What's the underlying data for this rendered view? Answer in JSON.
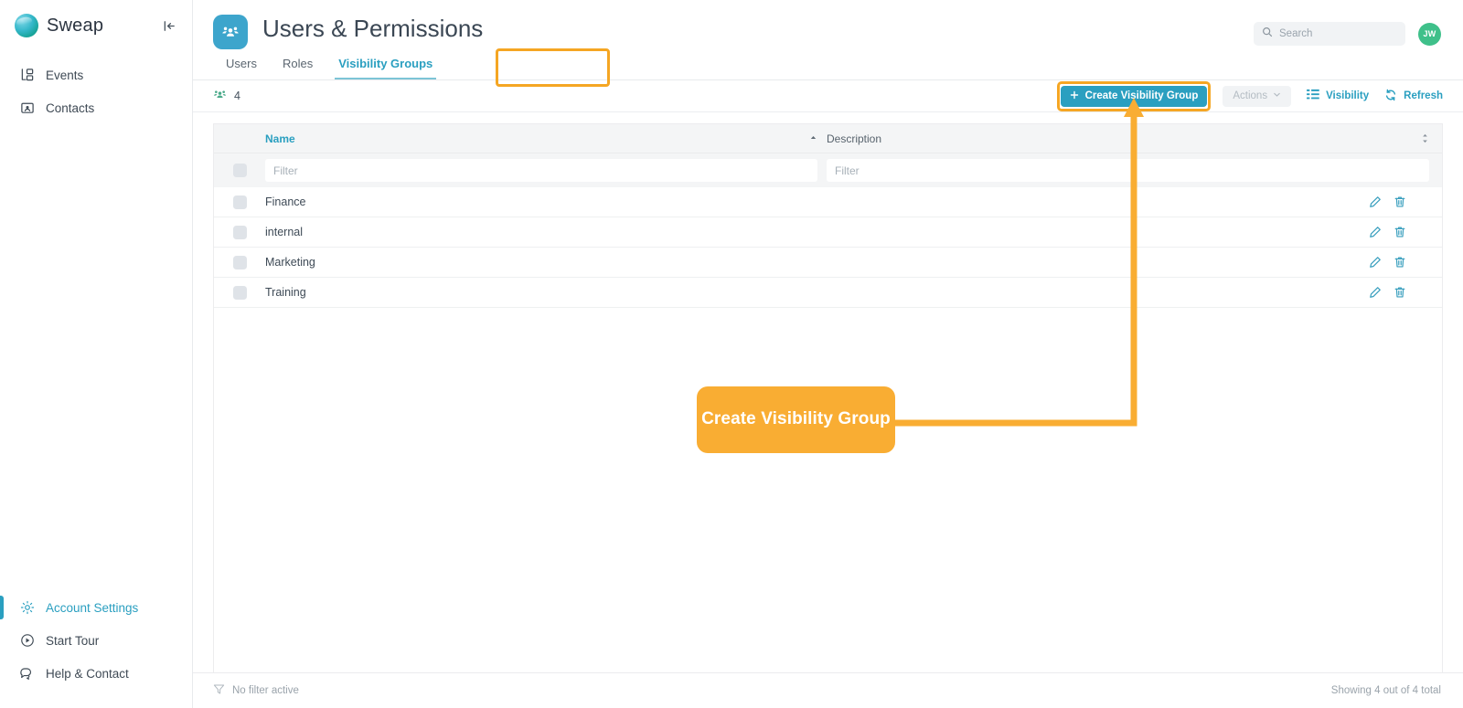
{
  "brand": {
    "name": "Sweap",
    "logo_icon": "sweap-logo-icon",
    "collapse_icon": "collapse-sidebar-icon"
  },
  "sidebar": {
    "top_items": [
      {
        "label": "Events",
        "icon": "events-icon"
      },
      {
        "label": "Contacts",
        "icon": "contacts-icon"
      }
    ],
    "bottom_items": [
      {
        "label": "Account Settings",
        "icon": "gear-icon",
        "active": true
      },
      {
        "label": "Start Tour",
        "icon": "play-circle-icon",
        "active": false
      },
      {
        "label": "Help & Contact",
        "icon": "chat-bubbles-icon",
        "active": false
      }
    ]
  },
  "header": {
    "title": "Users & Permissions",
    "page_icon": "users-permissions-icon",
    "search": {
      "placeholder": "Search",
      "value": "",
      "icon": "search-icon"
    },
    "avatar": {
      "initials": "JW",
      "color": "#3fc08a"
    }
  },
  "tabs": [
    {
      "label": "Users",
      "active": false
    },
    {
      "label": "Roles",
      "active": false
    },
    {
      "label": "Visibility Groups",
      "active": true,
      "highlighted": true
    }
  ],
  "toolbar": {
    "count_icon": "users-group-icon",
    "count": "4",
    "create_button": {
      "label": "Create Visibility Group",
      "icon": "plus-icon",
      "highlighted": true
    },
    "actions_button": {
      "label": "Actions",
      "icon": "chevron-down-icon",
      "disabled": true
    },
    "visibility_button": {
      "label": "Visibility",
      "icon": "columns-list-icon"
    },
    "refresh_button": {
      "label": "Refresh",
      "icon": "refresh-icon"
    }
  },
  "table": {
    "columns": [
      {
        "label": "Name",
        "sorted": "asc",
        "sort_icon": "sort-asc-icon"
      },
      {
        "label": "Description",
        "sorted": "none",
        "sort_icon": "sort-none-icon"
      }
    ],
    "filters": [
      {
        "placeholder": "Filter",
        "value": ""
      },
      {
        "placeholder": "Filter",
        "value": ""
      }
    ],
    "rows": [
      {
        "name": "Finance",
        "description": ""
      },
      {
        "name": "internal",
        "description": ""
      },
      {
        "name": "Marketing",
        "description": ""
      },
      {
        "name": "Training",
        "description": ""
      }
    ],
    "row_actions": [
      {
        "name": "edit-icon",
        "label": "Edit"
      },
      {
        "name": "delete-icon",
        "label": "Delete"
      }
    ]
  },
  "footer": {
    "filter_status": "No filter active",
    "filter_icon": "funnel-icon",
    "showing": "Showing 4 out of 4 total"
  },
  "callout": {
    "text": "Create Visibility Group",
    "color": "#f9ad33"
  },
  "colors": {
    "accent": "#2a9fc0",
    "highlight": "#f5a623",
    "callout": "#f9ad33",
    "avatar": "#3fc08a"
  }
}
